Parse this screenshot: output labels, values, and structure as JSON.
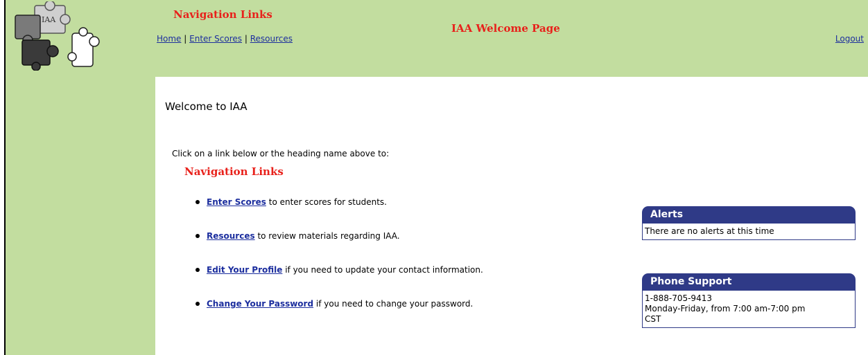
{
  "header": {
    "nav_heading": "Navigation Links",
    "nav_links": [
      "Home",
      "Enter Scores",
      "Resources"
    ],
    "separator": "|",
    "page_title": "IAA Welcome Page",
    "logout": "Logout",
    "logo_text": "IAA"
  },
  "main": {
    "welcome": "Welcome to IAA",
    "intro": "Click on a link below or the heading name above to:",
    "nav_heading": "Navigation Links",
    "links": [
      {
        "link": "Enter Scores",
        "text": " to enter scores for students."
      },
      {
        "link": "Resources",
        "text": " to review materials regarding IAA."
      },
      {
        "link": "Edit Your Profile",
        "text": " if you need to update your contact information."
      },
      {
        "link": "Change Your Password",
        "text": " if you need to change your password."
      }
    ]
  },
  "alerts": {
    "title": "Alerts",
    "body": "There are no alerts at this time"
  },
  "phone": {
    "title": "Phone Support",
    "line1": "1-888-705-9413",
    "line2": "Monday-Friday, from 7:00 am-7:00 pm",
    "line3": "CST"
  },
  "colors": {
    "background": "#c2dd9f",
    "accent_red": "#e8211b",
    "link_blue": "#1c2e9e",
    "panel_navy": "#2f3a87"
  }
}
